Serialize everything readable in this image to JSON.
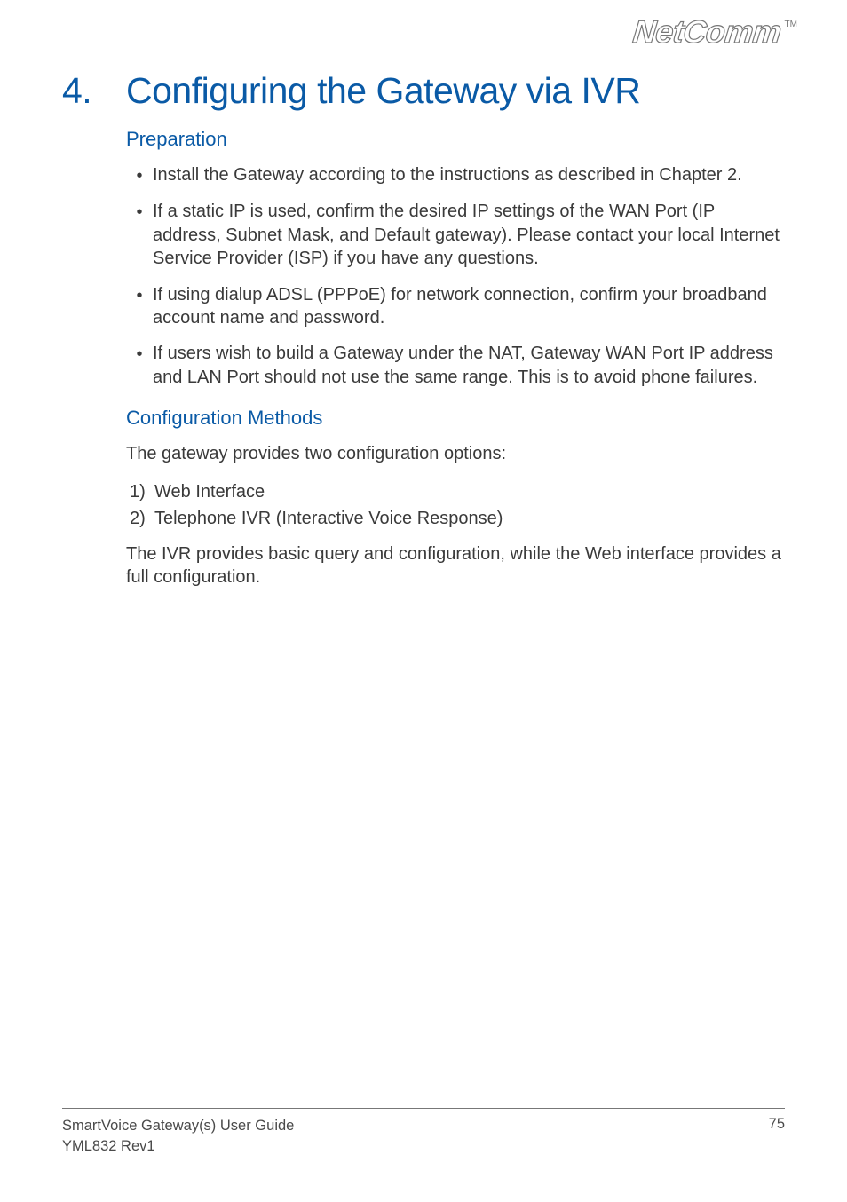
{
  "brand": {
    "name": "NetComm",
    "tm": "TM"
  },
  "chapter": {
    "number": "4.",
    "title": "Configuring the Gateway via IVR"
  },
  "sections": {
    "preparation": {
      "heading": "Preparation",
      "bullets": [
        "Install the Gateway according to the instructions as described in Chapter 2.",
        "If a static IP is used, confirm the desired IP settings of the WAN Port (IP address, Subnet Mask, and Default gateway). Please contact your local Internet Service Provider (ISP) if you have any questions.",
        "If using dialup ADSL (PPPoE) for network connection, confirm your broadband account name and password.",
        "If users wish to build a Gateway under the NAT, Gateway WAN Port IP address and LAN Port should not use the same range. This is to avoid phone failures."
      ]
    },
    "config_methods": {
      "heading": "Configuration Methods",
      "intro": "The gateway provides two configuration options:",
      "items": [
        "Web Interface",
        "Telephone IVR (Interactive Voice Response)"
      ],
      "outro": "The IVR provides basic query and configuration, while the Web interface provides a full configuration."
    }
  },
  "footer": {
    "guide": "SmartVoice Gateway(s) User Guide",
    "rev": "YML832 Rev1",
    "page": "75"
  }
}
